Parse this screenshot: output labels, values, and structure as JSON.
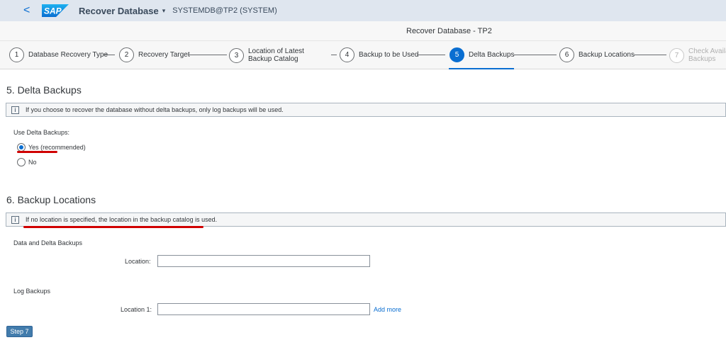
{
  "shell": {
    "back_glyph": "<",
    "app_title": "Recover Database",
    "caret_glyph": "▾",
    "system_id": "SYSTEMDB@TP2 (SYSTEM)"
  },
  "wizard": {
    "title": "Recover Database - TP2",
    "steps": [
      {
        "num": "1",
        "label": "Database Recovery Type"
      },
      {
        "num": "2",
        "label": "Recovery Target"
      },
      {
        "num": "3",
        "label": "Location of Latest Backup Catalog"
      },
      {
        "num": "4",
        "label": "Backup to be Used"
      },
      {
        "num": "5",
        "label": "Delta Backups"
      },
      {
        "num": "6",
        "label": "Backup Locations"
      },
      {
        "num": "7",
        "label": "Check Availa Backups"
      }
    ],
    "active_step": 5
  },
  "delta": {
    "title": "5. Delta Backups",
    "info": "If you choose to recover the database without delta backups, only log backups will be used.",
    "field_label": "Use Delta Backups:",
    "options": [
      "Yes (recommended)",
      "No"
    ],
    "selected": "Yes (recommended)"
  },
  "locations": {
    "title": "6. Backup Locations",
    "info": "If no location is specified, the location in the backup catalog is used.",
    "data_group": "Data and Delta Backups",
    "data_location_label": "Location:",
    "data_location_value": "",
    "log_group": "Log Backups",
    "log_location_label": "Location 1:",
    "log_location_value": "",
    "add_more": "Add more"
  },
  "footer": {
    "step7_button": "Step 7"
  },
  "icons": {
    "info": "info-icon",
    "back": "chevron-left-icon",
    "logo": "sap-logo"
  },
  "colors": {
    "accent": "#0a6ed1",
    "annotation": "#d00000",
    "shell": "#dfe6ef"
  }
}
